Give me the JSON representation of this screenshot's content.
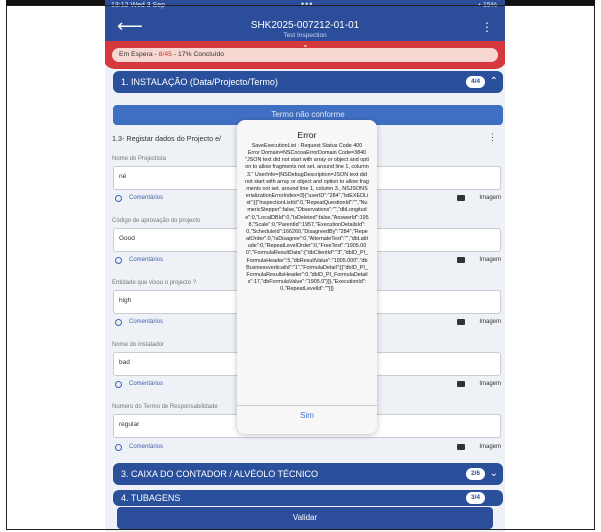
{
  "status_bar": {
    "time": "13:12 Wed 3 Sep",
    "dots": "•••",
    "battery": "15%"
  },
  "header": {
    "title": "SHK2025-007212-01-01",
    "subtitle": "Test Inspection",
    "back_icon": "back-arrow-icon",
    "menu_icon": "kebab-menu-icon"
  },
  "progress_pill": {
    "text_prefix": "Em Espera - ",
    "count": "8/45",
    "text_suffix": " - 17% Concluído"
  },
  "sections": [
    {
      "label": "1. INSTALAÇÃO (Data/Projecto/Termo)",
      "badge": "4/4",
      "expanded": true
    },
    {
      "label": "3. CAIXA DO CONTADOR / ALVÉOLO TÉCNICO",
      "badge": "2/6",
      "expanded": false
    },
    {
      "label": "4. TUBAGENS",
      "badge": "3/4",
      "expanded": false
    }
  ],
  "nonconformity_button": "Termo não conforme",
  "question_title": "1.3- Registar dados do Projecto e/",
  "fields": [
    {
      "label": "Nome do Projectista",
      "value": "né"
    },
    {
      "label": "Código de aprovação do projecto",
      "value": "Good"
    },
    {
      "label": "Entidade que visou o projecto ?",
      "value": "high"
    },
    {
      "label": "Nome do instalador",
      "value": "bad"
    },
    {
      "label": "Numero do Termo de Responsabilidade",
      "value": "regular"
    }
  ],
  "row_actions": {
    "comments_label": "Comentários",
    "image_label": "Imagem"
  },
  "validate_button": "Validar",
  "alert": {
    "title": "Error",
    "message": "SaveExecutionList : Request Status Code 400\nError Domain=NSCocoaErrorDomain Code=3840 \"JSON text did not start with array or object and option to allow fragments not set. around line 1, column 3.\" UserInfo={NSDebugDescription=JSON text did not start with array or object and option to allow fragments not set. around line 1, column 3., NSJSONSerializationErrorIndex=3}{\"userID\":\"284\",\"lstEXEDList\":[{\"InspectionListId\":0,\"RepeatQuestionId\":\"\",\"NumericStepper\":false,\"Observations\":\"\",\"dbLongitude\":0,\"LocalDBId\":0,\"IsDeleted\":false,\"AnswerId\":1958,\"Scale\":0,\"ParentId\":1957,\"ExecutionDetailsId\":0,\"ScheduleId\":166260,\"DisagreedBy\":\"284\",\"RepeatOrder\":0,\"IsDisagree\":0,\"AlternateText\":\"\",\"dbLatitude\":0,\"RepeatLevelOrder\":0,\"FreeText\":\"1905.000\",\"FormulaResultData\":{\"dbClientId\":\"3\",\"dbID_PI_FormulaHeader\":5,\"dbResultValue\":\"1905.000\",\"dbBusinessverticalId\":\"1\",\"FormulaDetail\":[{\"dbID_PI_FormulaResultsHeader\":0,\"dbID_PI_FormulaDetails\":17,\"dbFormulaValue\":\"1905.0\"}]},\"ExecutionId\":0,\"RepeatLevelId\":\"\"}]}",
    "button": "Sim"
  }
}
